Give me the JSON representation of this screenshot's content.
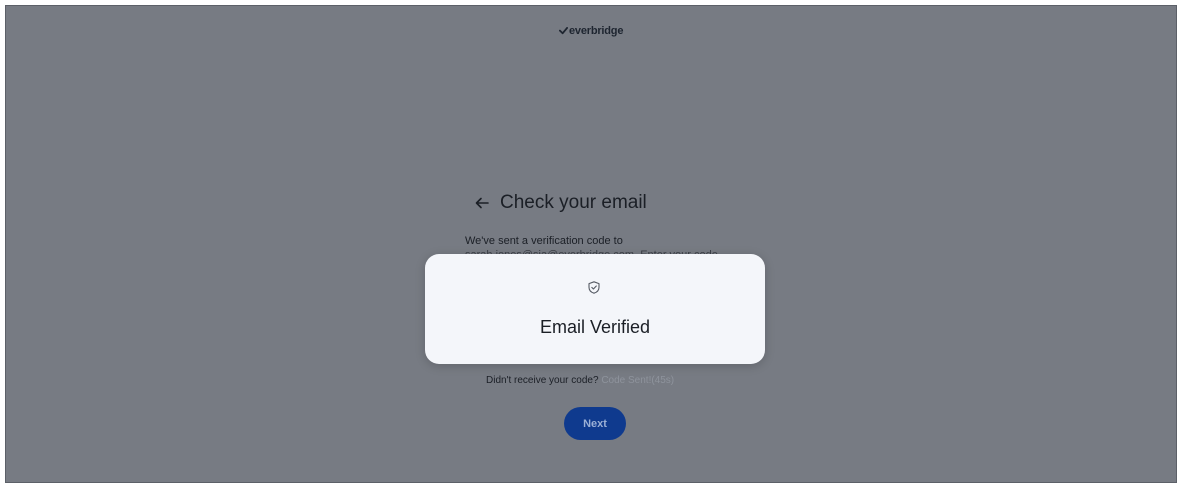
{
  "brand": {
    "name": "everbridge",
    "accent": "#0f3a8e"
  },
  "header": {
    "title": "Check your email",
    "back_icon": "arrow-left-icon"
  },
  "body": {
    "description": "We've sent a verification code to",
    "obscured_line": "sarah.jones@sia@everbridge.com. Enter your code"
  },
  "modal": {
    "icon": "shield-check-icon",
    "message": "Email Verified"
  },
  "resend": {
    "prompt": "Didn't receive your code?",
    "status": "Code Sent!(45s)"
  },
  "actions": {
    "next_label": "Next"
  }
}
